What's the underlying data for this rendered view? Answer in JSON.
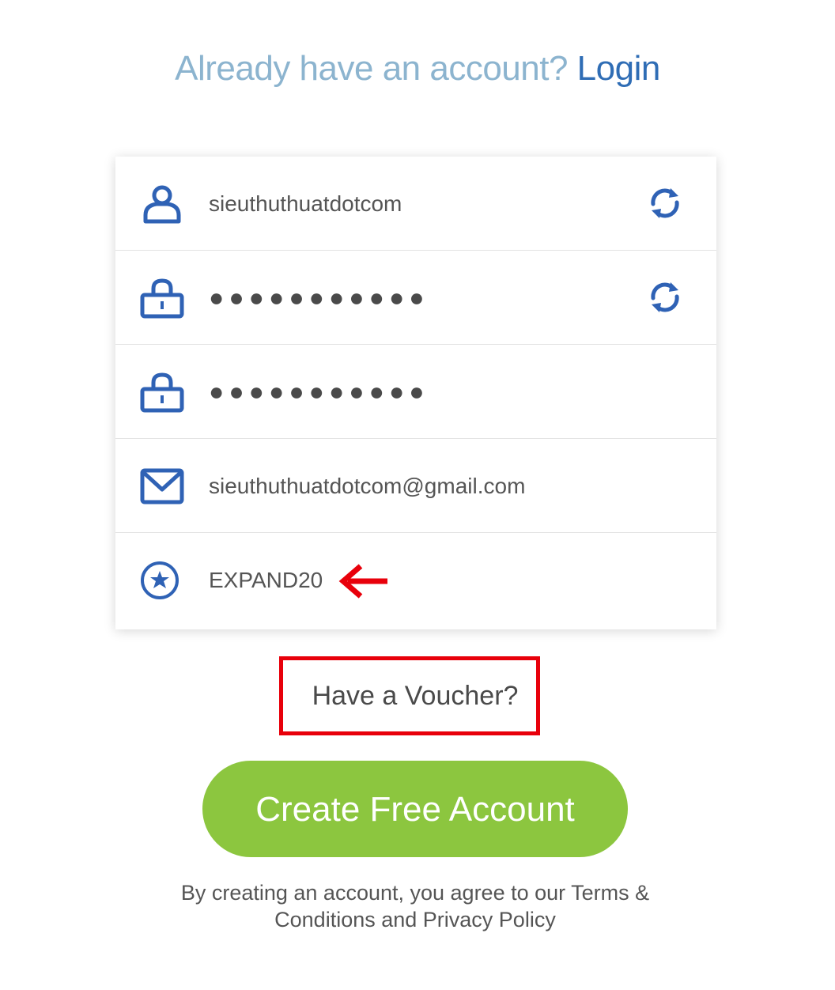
{
  "header": {
    "prompt": "Already have an account?",
    "login_link": "Login"
  },
  "form": {
    "username": "sieuthuthuatdotcom",
    "password": "●●●●●●●●●●●",
    "confirm_password": "●●●●●●●●●●●",
    "email": "sieuthuthuatdotcom@gmail.com",
    "voucher_code": "EXPAND20"
  },
  "voucher_link": "Have a Voucher?",
  "create_button": "Create Free Account",
  "legal": {
    "text": "By creating an account, you agree to our Terms & Conditions and Privacy Policy"
  },
  "colors": {
    "icon_blue": "#2f62b5",
    "login_blue": "#2f6db5",
    "muted_blue": "#8cb4cf",
    "button_green": "#8cc63f",
    "annotation_red": "#e8000b"
  },
  "icons": {
    "username": "user-icon",
    "password": "lock-icon",
    "confirm_password": "lock-icon",
    "email": "envelope-icon",
    "voucher": "star-circle-icon",
    "refresh": "refresh-icon",
    "annotation": "arrow-left-icon"
  }
}
